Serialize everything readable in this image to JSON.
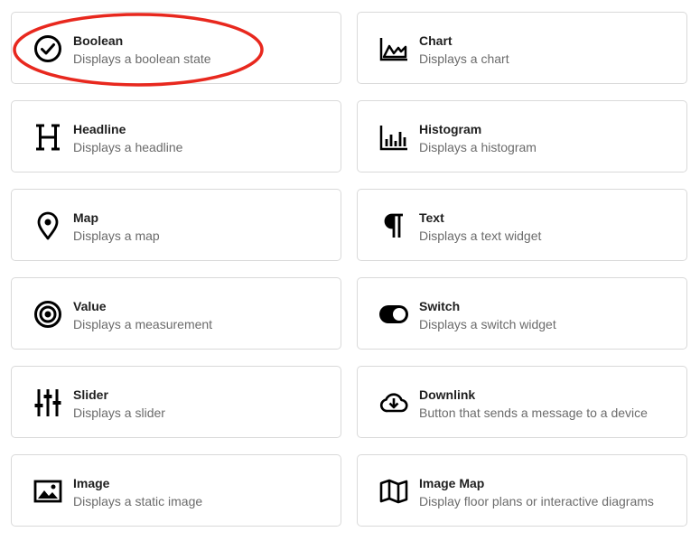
{
  "widgets": [
    {
      "title": "Boolean",
      "desc": "Displays a boolean state",
      "icon": "check-circle-icon"
    },
    {
      "title": "Chart",
      "desc": "Displays a chart",
      "icon": "area-chart-icon"
    },
    {
      "title": "Headline",
      "desc": "Displays a headline",
      "icon": "heading-icon"
    },
    {
      "title": "Histogram",
      "desc": "Displays a histogram",
      "icon": "histogram-icon"
    },
    {
      "title": "Map",
      "desc": "Displays a map",
      "icon": "map-pin-icon"
    },
    {
      "title": "Text",
      "desc": "Displays a text widget",
      "icon": "paragraph-icon"
    },
    {
      "title": "Value",
      "desc": "Displays a measurement",
      "icon": "target-icon"
    },
    {
      "title": "Switch",
      "desc": "Displays a switch widget",
      "icon": "toggle-icon"
    },
    {
      "title": "Slider",
      "desc": "Displays a slider",
      "icon": "sliders-icon"
    },
    {
      "title": "Downlink",
      "desc": "Button that sends a message to a device",
      "icon": "cloud-download-icon"
    },
    {
      "title": "Image",
      "desc": "Displays a static image",
      "icon": "image-icon"
    },
    {
      "title": "Image Map",
      "desc": "Display floor plans or interactive diagrams",
      "icon": "folded-map-icon"
    }
  ],
  "colors": {
    "annotation": "#e8281e",
    "card_border": "#d9d9d9",
    "title": "#1f1f1f",
    "description": "#6b6b6b"
  }
}
